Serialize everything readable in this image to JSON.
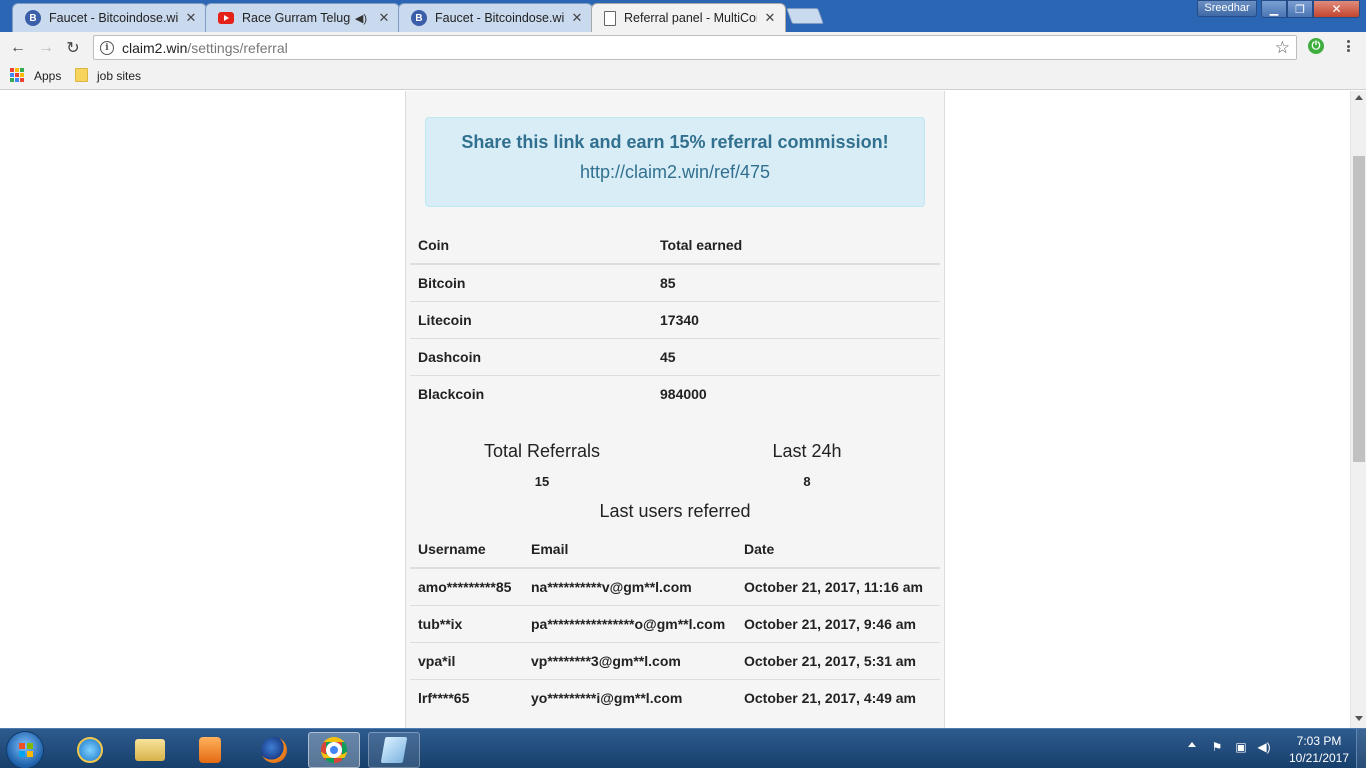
{
  "browser": {
    "tabs": [
      {
        "title": "Faucet - Bitcoindose.win",
        "favicon": "bitcoin-icon",
        "active": false
      },
      {
        "title": "Race Gurram Telugu F",
        "favicon": "youtube-icon",
        "audio": true,
        "active": false
      },
      {
        "title": "Faucet - Bitcoindose.win",
        "favicon": "bitcoin-icon",
        "active": false
      },
      {
        "title": "Referral panel - MultiCoi",
        "favicon": "document-icon",
        "active": true
      }
    ],
    "profile_name": "Sreedhar",
    "url_host": "claim2.win",
    "url_path": "/settings/referral",
    "bookmarks": [
      {
        "label": "Apps"
      },
      {
        "label": "job sites"
      }
    ]
  },
  "referral": {
    "heading": "Share this link and earn 15% referral commission!",
    "link": "http://claim2.win/ref/475"
  },
  "earnings": {
    "headers": [
      "Coin",
      "Total earned"
    ],
    "rows": [
      [
        "Bitcoin",
        "85"
      ],
      [
        "Litecoin",
        "17340"
      ],
      [
        "Dashcoin",
        "45"
      ],
      [
        "Blackcoin",
        "984000"
      ]
    ]
  },
  "stats": {
    "total_referrals_label": "Total Referrals",
    "total_referrals_value": "15",
    "last24h_label": "Last 24h",
    "last24h_value": "8"
  },
  "last_users": {
    "title": "Last users referred",
    "headers": [
      "Username",
      "Email",
      "Date"
    ],
    "rows": [
      [
        "amo*********85",
        "na**********v@gm**l.com",
        "October 21, 2017, 11:16 am"
      ],
      [
        "tub**ix",
        "pa****************o@gm**l.com",
        "October 21, 2017, 9:46 am"
      ],
      [
        "vpa*il",
        "vp********3@gm**l.com",
        "October 21, 2017, 5:31 am"
      ],
      [
        "lrf****65",
        "yo*********i@gm**l.com",
        "October 21, 2017, 4:49 am"
      ]
    ]
  },
  "taskbar": {
    "time": "7:03 PM",
    "date": "10/21/2017"
  },
  "colors": {
    "alert_bg": "#d9edf7",
    "alert_text": "#31708f",
    "panel_bg": "#f5f5f5",
    "titlebar": "#2a66b3"
  }
}
